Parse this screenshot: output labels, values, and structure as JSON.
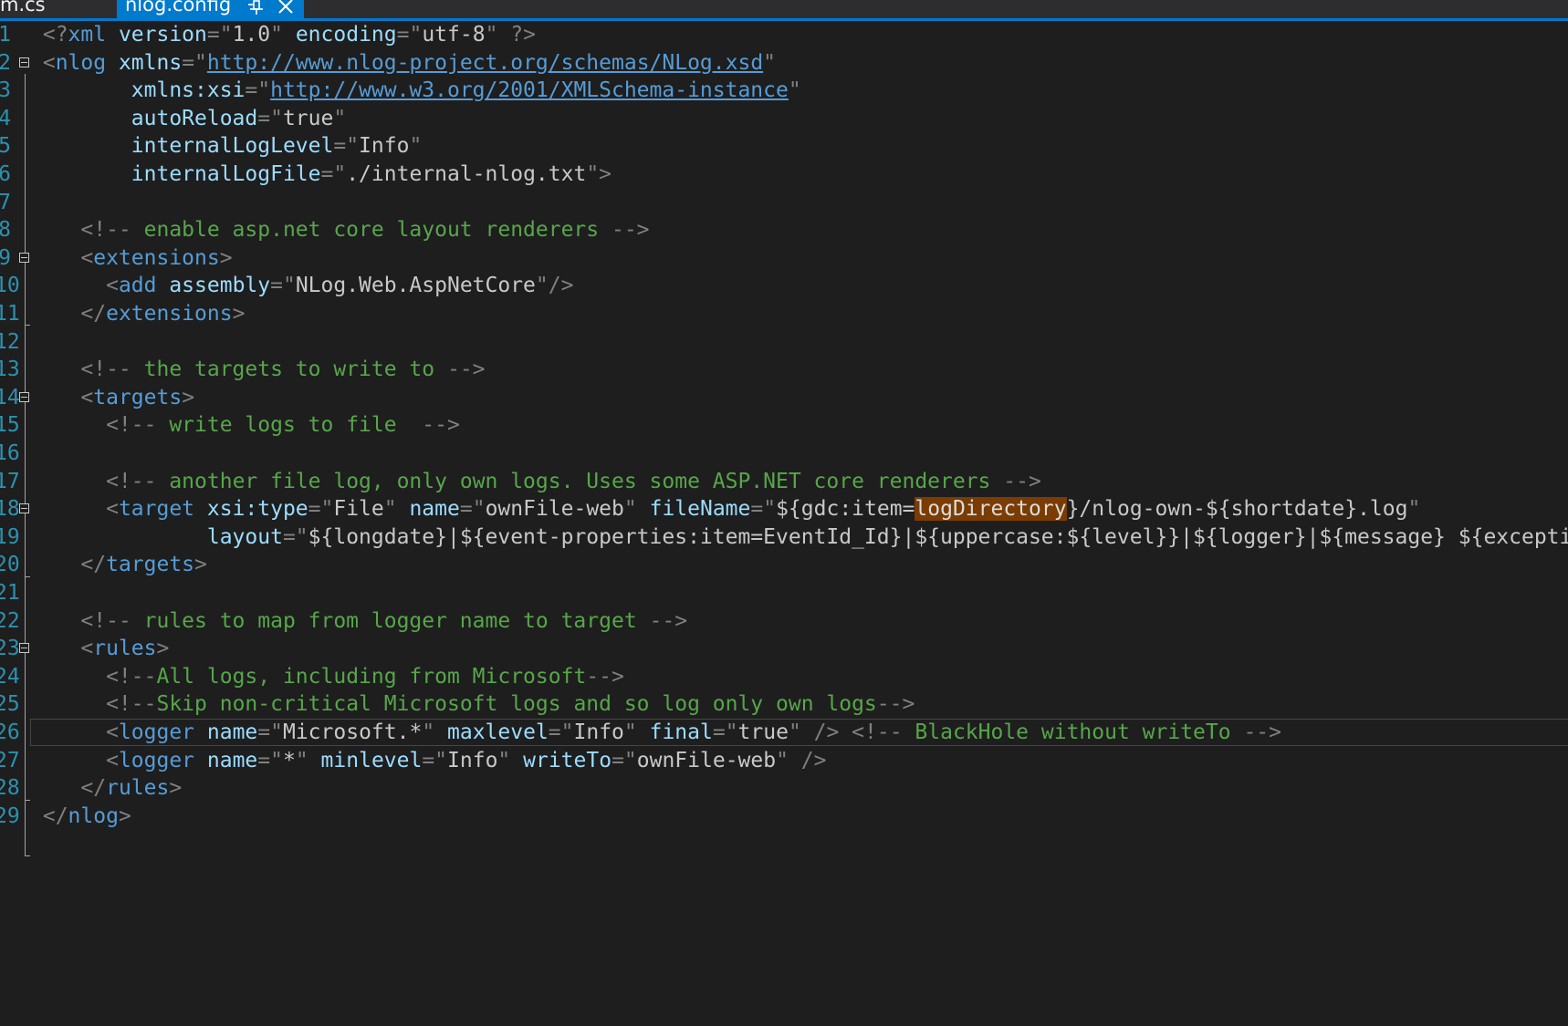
{
  "tabs": [
    {
      "label": "m.cs",
      "active": false
    },
    {
      "label": "nlog.config",
      "active": true
    }
  ],
  "colors": {
    "tag": "#569cd6",
    "attribute": "#9cdcfe",
    "comment": "#57a64a",
    "punctuation": "#808080",
    "value": "#c8c8c8",
    "line_number": "#2b91af",
    "highlight": "#7a3c00",
    "accent": "#007acc"
  },
  "current_line_number": "26",
  "lines": [
    {
      "n": "1",
      "tokens": [
        [
          "p",
          " <?"
        ],
        [
          "t",
          "xml"
        ],
        [
          "a",
          " version"
        ],
        [
          "p",
          "=\""
        ],
        [
          "v",
          "1.0"
        ],
        [
          "p",
          "\""
        ],
        [
          "a",
          " encoding"
        ],
        [
          "p",
          "=\""
        ],
        [
          "v",
          "utf-8"
        ],
        [
          "p",
          "\" ?>"
        ]
      ]
    },
    {
      "n": "2",
      "fold": true,
      "tokens": [
        [
          "p",
          " <"
        ],
        [
          "t",
          "nlog"
        ],
        [
          "a",
          " xmlns"
        ],
        [
          "p",
          "=\""
        ],
        [
          "l",
          "http://www.nlog-project.org/schemas/NLog.xsd"
        ],
        [
          "p",
          "\""
        ]
      ]
    },
    {
      "n": "3",
      "tokens": [
        [
          "a",
          "        xmlns:xsi"
        ],
        [
          "p",
          "=\""
        ],
        [
          "l",
          "http://www.w3.org/2001/XMLSchema-instance"
        ],
        [
          "p",
          "\""
        ]
      ]
    },
    {
      "n": "4",
      "tokens": [
        [
          "a",
          "        autoReload"
        ],
        [
          "p",
          "=\""
        ],
        [
          "v",
          "true"
        ],
        [
          "p",
          "\""
        ]
      ]
    },
    {
      "n": "5",
      "tokens": [
        [
          "a",
          "        internalLogLevel"
        ],
        [
          "p",
          "=\""
        ],
        [
          "v",
          "Info"
        ],
        [
          "p",
          "\""
        ]
      ]
    },
    {
      "n": "6",
      "tokens": [
        [
          "a",
          "        internalLogFile"
        ],
        [
          "p",
          "=\""
        ],
        [
          "v",
          "./internal-nlog.txt"
        ],
        [
          "p",
          "\">"
        ]
      ]
    },
    {
      "n": "7",
      "tokens": []
    },
    {
      "n": "8",
      "tokens": [
        [
          "p",
          "    <!--"
        ],
        [
          "c",
          " enable asp.net core layout renderers "
        ],
        [
          "p",
          "-->"
        ]
      ]
    },
    {
      "n": "9",
      "fold": true,
      "tokens": [
        [
          "p",
          "    <"
        ],
        [
          "t",
          "extensions"
        ],
        [
          "p",
          ">"
        ]
      ]
    },
    {
      "n": "10",
      "tokens": [
        [
          "p",
          "      <"
        ],
        [
          "t",
          "add"
        ],
        [
          "a",
          " assembly"
        ],
        [
          "p",
          "=\""
        ],
        [
          "v",
          "NLog.Web.AspNetCore"
        ],
        [
          "p",
          "\"/>"
        ]
      ]
    },
    {
      "n": "11",
      "tokens": [
        [
          "p",
          "    </"
        ],
        [
          "t",
          "extensions"
        ],
        [
          "p",
          ">"
        ]
      ]
    },
    {
      "n": "12",
      "tokens": []
    },
    {
      "n": "13",
      "tokens": [
        [
          "p",
          "    <!--"
        ],
        [
          "c",
          " the targets to write to "
        ],
        [
          "p",
          "-->"
        ]
      ]
    },
    {
      "n": "14",
      "fold": true,
      "tokens": [
        [
          "p",
          "    <"
        ],
        [
          "t",
          "targets"
        ],
        [
          "p",
          ">"
        ]
      ]
    },
    {
      "n": "15",
      "tokens": [
        [
          "p",
          "      <!--"
        ],
        [
          "c",
          " write logs to file  "
        ],
        [
          "p",
          "-->"
        ]
      ]
    },
    {
      "n": "16",
      "tokens": []
    },
    {
      "n": "17",
      "tokens": [
        [
          "p",
          "      <!--"
        ],
        [
          "c",
          " another file log, only own logs. Uses some ASP.NET core renderers "
        ],
        [
          "p",
          "-->"
        ]
      ]
    },
    {
      "n": "18",
      "fold": true,
      "tokens": [
        [
          "p",
          "      <"
        ],
        [
          "t",
          "target"
        ],
        [
          "a",
          " xsi:type"
        ],
        [
          "p",
          "=\""
        ],
        [
          "v",
          "File"
        ],
        [
          "p",
          "\""
        ],
        [
          "a",
          " name"
        ],
        [
          "p",
          "=\""
        ],
        [
          "v",
          "ownFile-web"
        ],
        [
          "p",
          "\""
        ],
        [
          "a",
          " fileName"
        ],
        [
          "p",
          "=\""
        ],
        [
          "v",
          "${gdc:item="
        ],
        [
          "h",
          "logDirectory"
        ],
        [
          "v",
          "}/nlog-own-${shortdate}.log"
        ],
        [
          "p",
          "\""
        ]
      ]
    },
    {
      "n": "19",
      "tokens": [
        [
          "a",
          "              layout"
        ],
        [
          "p",
          "=\""
        ],
        [
          "v",
          "${longdate}|${event-properties:item=EventId_Id}|${uppercase:${level}}|${logger}|${message} ${exceptio"
        ]
      ]
    },
    {
      "n": "20",
      "tokens": [
        [
          "p",
          "    </"
        ],
        [
          "t",
          "targets"
        ],
        [
          "p",
          ">"
        ]
      ]
    },
    {
      "n": "21",
      "tokens": []
    },
    {
      "n": "22",
      "tokens": [
        [
          "p",
          "    <!--"
        ],
        [
          "c",
          " rules to map from logger name to target "
        ],
        [
          "p",
          "-->"
        ]
      ]
    },
    {
      "n": "23",
      "fold": true,
      "tokens": [
        [
          "p",
          "    <"
        ],
        [
          "t",
          "rules"
        ],
        [
          "p",
          ">"
        ]
      ]
    },
    {
      "n": "24",
      "tokens": [
        [
          "p",
          "      <!--"
        ],
        [
          "c",
          "All logs, including from Microsoft"
        ],
        [
          "p",
          "-->"
        ]
      ]
    },
    {
      "n": "25",
      "tokens": [
        [
          "p",
          "      <!--"
        ],
        [
          "c",
          "Skip non-critical Microsoft logs and so log only own logs"
        ],
        [
          "p",
          "-->"
        ]
      ]
    },
    {
      "n": "26",
      "tokens": [
        [
          "p",
          "      <"
        ],
        [
          "t",
          "logger"
        ],
        [
          "a",
          " name"
        ],
        [
          "p",
          "=\""
        ],
        [
          "v",
          "Microsoft.*"
        ],
        [
          "p",
          "\""
        ],
        [
          "a",
          " maxlevel"
        ],
        [
          "p",
          "=\""
        ],
        [
          "v",
          "Info"
        ],
        [
          "p",
          "\""
        ],
        [
          "a",
          " final"
        ],
        [
          "p",
          "=\""
        ],
        [
          "v",
          "true"
        ],
        [
          "p",
          "\" /> <!--"
        ],
        [
          "c",
          " BlackHole without writeTo "
        ],
        [
          "p",
          "-->"
        ]
      ]
    },
    {
      "n": "27",
      "tokens": [
        [
          "p",
          "      <"
        ],
        [
          "t",
          "logger"
        ],
        [
          "a",
          " name"
        ],
        [
          "p",
          "=\""
        ],
        [
          "v",
          "*"
        ],
        [
          "p",
          "\""
        ],
        [
          "a",
          " minlevel"
        ],
        [
          "p",
          "=\""
        ],
        [
          "v",
          "Info"
        ],
        [
          "p",
          "\""
        ],
        [
          "a",
          " writeTo"
        ],
        [
          "p",
          "=\""
        ],
        [
          "v",
          "ownFile-web"
        ],
        [
          "p",
          "\" />"
        ]
      ]
    },
    {
      "n": "28",
      "tokens": [
        [
          "p",
          "    </"
        ],
        [
          "t",
          "rules"
        ],
        [
          "p",
          ">"
        ]
      ]
    },
    {
      "n": "29",
      "tokens": [
        [
          "p",
          " </"
        ],
        [
          "t",
          "nlog"
        ],
        [
          "p",
          ">"
        ]
      ]
    }
  ]
}
